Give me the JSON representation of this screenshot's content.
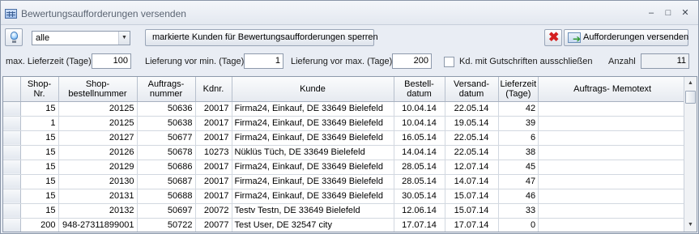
{
  "window": {
    "title": "Bewertungsaufforderungen versenden",
    "controls": {
      "minimize": "–",
      "maximize": "□",
      "close": "✕"
    }
  },
  "toolbar": {
    "filter_select": {
      "value": "alle"
    },
    "block_button": "markierte Kunden für Bewertungsaufforderungen sperren",
    "send_button": "Aufforderungen versenden"
  },
  "filters": {
    "max_lieferzeit_label": "max. Lieferzeit (Tage)",
    "max_lieferzeit_value": "100",
    "lieferung_min_label": "Lieferung vor min. (Tage)",
    "lieferung_min_value": "1",
    "lieferung_max_label": "Lieferung vor max. (Tage)",
    "lieferung_max_value": "200",
    "gutschriften_label": "Kd. mit Gutschriften ausschließen",
    "gutschriften_checked": false,
    "anzahl_label": "Anzahl",
    "anzahl_value": "11"
  },
  "table": {
    "headers": [
      "Shop-Nr.",
      "Shop-bestellnummer",
      "Auftrags-nummer",
      "Kdnr.",
      "Kunde",
      "Bestell-datum",
      "Versand-datum",
      "Lieferzeit (Tage)",
      "Auftrags- Memotext"
    ],
    "rows": [
      [
        "15",
        "20125",
        "50636",
        "20017",
        "Firma24, Einkauf, DE 33649 Bielefeld",
        "10.04.14",
        "22.05.14",
        "42",
        ""
      ],
      [
        "1",
        "20125",
        "50638",
        "20017",
        "Firma24, Einkauf, DE 33649 Bielefeld",
        "10.04.14",
        "19.05.14",
        "39",
        ""
      ],
      [
        "15",
        "20127",
        "50677",
        "20017",
        "Firma24, Einkauf, DE 33649 Bielefeld",
        "16.05.14",
        "22.05.14",
        "6",
        ""
      ],
      [
        "15",
        "20126",
        "50678",
        "10273",
        "Nüklüs Tüch, DE 33649 Bielefeld",
        "14.04.14",
        "22.05.14",
        "38",
        ""
      ],
      [
        "15",
        "20129",
        "50686",
        "20017",
        "Firma24, Einkauf, DE 33649 Bielefeld",
        "28.05.14",
        "12.07.14",
        "45",
        ""
      ],
      [
        "15",
        "20130",
        "50687",
        "20017",
        "Firma24, Einkauf, DE 33649 Bielefeld",
        "28.05.14",
        "14.07.14",
        "47",
        ""
      ],
      [
        "15",
        "20131",
        "50688",
        "20017",
        "Firma24, Einkauf, DE 33649 Bielefeld",
        "30.05.14",
        "15.07.14",
        "46",
        ""
      ],
      [
        "15",
        "20132",
        "50697",
        "20072",
        "Testv Testn, DE 33649 Bielefeld",
        "12.06.14",
        "15.07.14",
        "33",
        ""
      ],
      [
        "200",
        "948-27311899001",
        "50722",
        "20077",
        "Test User, DE 32547 city",
        "17.07.14",
        "17.07.14",
        "0",
        ""
      ]
    ]
  }
}
